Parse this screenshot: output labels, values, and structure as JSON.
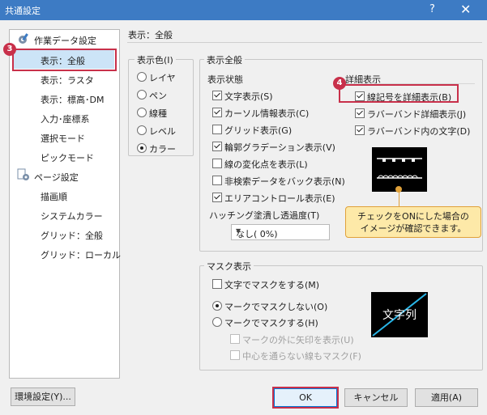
{
  "window": {
    "title": "共通設定",
    "help": "?",
    "close": "✕"
  },
  "tree": {
    "groups": [
      {
        "label": "作業データ設定",
        "icon": "gear-pen-icon"
      },
      {
        "label": "ページ設定",
        "icon": "page-gear-icon"
      }
    ],
    "items1": [
      "表示：全般",
      "表示：ラスタ",
      "表示：標高･DM",
      "入力･座標系",
      "選択モード",
      "ピックモード"
    ],
    "items2": [
      "描画順",
      "システムカラー",
      "グリッド：全般",
      "グリッド：ローカル"
    ]
  },
  "badges": {
    "b3": "3",
    "b4": "4"
  },
  "page_title": "表示：全般",
  "color_group": {
    "legend": "表示色(I)",
    "options": [
      "レイヤ",
      "ペン",
      "線種",
      "レベル",
      "カラー"
    ],
    "selected": "カラー"
  },
  "display_group": {
    "legend": "表示全般",
    "state_label": "表示状態",
    "detail_label": "詳細表示",
    "state_options": [
      {
        "label": "文字表示(S)",
        "checked": true
      },
      {
        "label": "カーソル情報表示(C)",
        "checked": true
      },
      {
        "label": "グリッド表示(G)",
        "checked": false
      },
      {
        "label": "輪郭グラデーション表示(V)",
        "checked": true
      },
      {
        "label": "線の変化点を表示(L)",
        "checked": false
      },
      {
        "label": "非検索データをバック表示(N)",
        "checked": false
      },
      {
        "label": "エリアコントロール表示(E)",
        "checked": true
      }
    ],
    "detail_options": [
      {
        "label": "線記号を詳細表示(B)",
        "checked": true
      },
      {
        "label": "ラバーバンド詳細表示(J)",
        "checked": true
      },
      {
        "label": "ラバーバンド内の文字(D)",
        "checked": true
      }
    ],
    "hatch_label": "ハッチング塗潰し透過度(T)",
    "hatch_value": "なし( 0%)"
  },
  "tooltip": {
    "line1": "チェックをONにした場合の",
    "line2": "イメージが確認できます。"
  },
  "mask_group": {
    "legend": "マスク表示",
    "mask_text": {
      "label": "文字でマスクをする(M)",
      "checked": false
    },
    "radio_no": {
      "label": "マークでマスクしない(O)",
      "checked": true
    },
    "radio_yes": {
      "label": "マークでマスクする(H)",
      "checked": false
    },
    "sub1": {
      "label": "マークの外に矢印を表示(U)",
      "checked": false
    },
    "sub2": {
      "label": "中心を通らない線もマスク(F)",
      "checked": false
    },
    "preview_text": "文字列"
  },
  "buttons": {
    "env": "環境設定(Y)...",
    "ok": "OK",
    "cancel": "キャンセル",
    "apply": "適用(A)"
  }
}
